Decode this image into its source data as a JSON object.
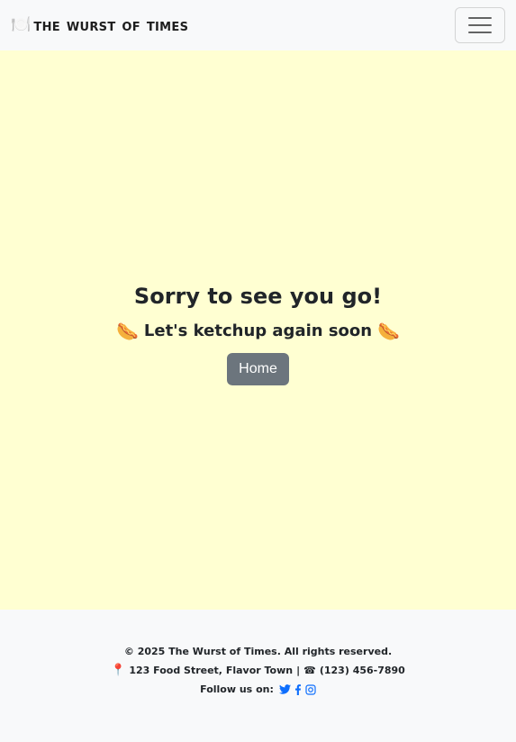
{
  "navbar": {
    "brand_icon": "🍽️",
    "brand_text": "The Wurst of Times",
    "toggler_label": "Toggle navigation"
  },
  "main": {
    "heading": "Sorry to see you go!",
    "subheading": "Let's ketchup again soon",
    "subheading_emoji": "🌭",
    "home_button": "Home"
  },
  "footer": {
    "copyright": "© 2025 The Wurst of Times. All rights reserved.",
    "address_icon": "📍",
    "address": "123 Food Street, Flavor Town",
    "separator": "|",
    "phone_icon": "☎",
    "phone": "(123) 456-7890",
    "follow_label": "Follow us on:",
    "social": [
      "twitter-icon",
      "facebook-icon",
      "instagram-icon"
    ]
  },
  "colors": {
    "main_bg": "#ffffd2",
    "page_bg": "#f8f9fa",
    "button_bg": "#6c757d",
    "link": "#0d6efd",
    "pin": "#d63384"
  }
}
